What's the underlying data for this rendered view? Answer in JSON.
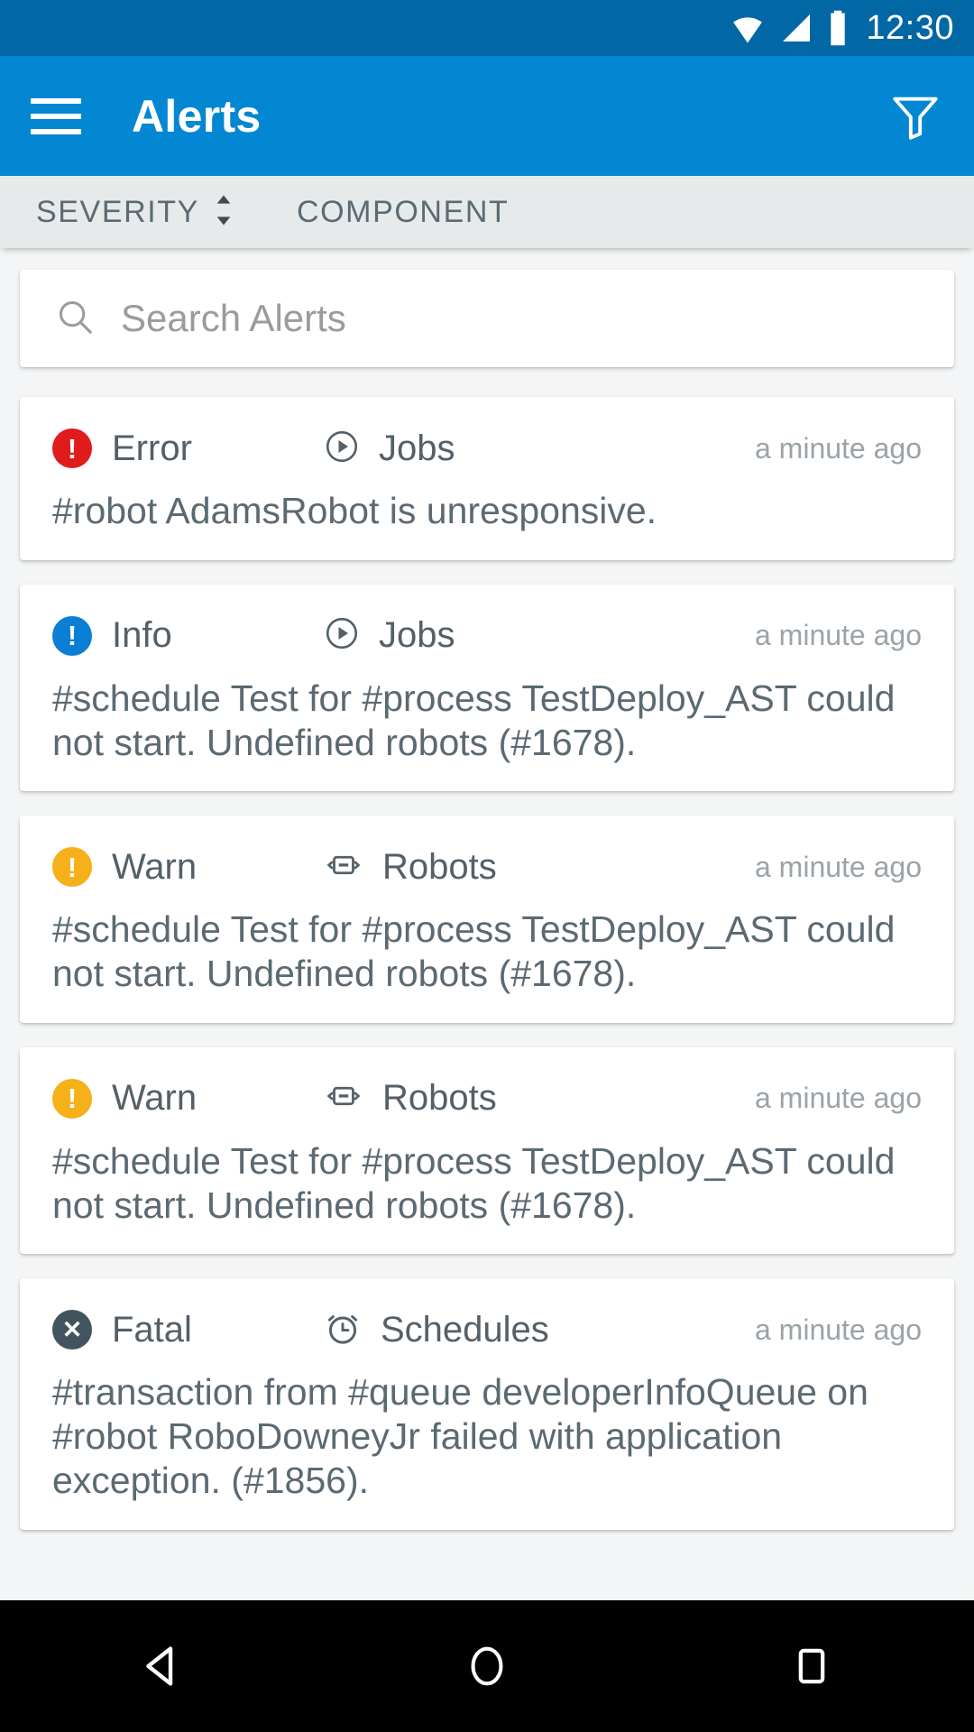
{
  "status_bar": {
    "time": "12:30",
    "icons": [
      "wifi-icon",
      "cellular-signal-icon",
      "battery-icon"
    ],
    "background_color": "#0267a5"
  },
  "app_bar": {
    "title": "Alerts",
    "menu_icon": "hamburger-menu-icon",
    "filter_icon": "filter-funnel-icon",
    "background_color": "#0487d2"
  },
  "sort_bar": {
    "items": [
      {
        "label": "SEVERITY",
        "icon": "sort-updown-icon",
        "active": true
      },
      {
        "label": "COMPONENT",
        "icon": "",
        "active": false
      }
    ]
  },
  "search": {
    "placeholder": "Search Alerts",
    "value": "",
    "icon": "search-icon"
  },
  "alerts": [
    {
      "severity": "Error",
      "severity_color": "#e01b1b",
      "severity_glyph": "!",
      "component": "Jobs",
      "component_icon": "play-circle-icon",
      "time": "a minute ago",
      "message": "#robot AdamsRobot is unresponsive."
    },
    {
      "severity": "Info",
      "severity_color": "#0b7fd4",
      "severity_glyph": "!",
      "component": "Jobs",
      "component_icon": "play-circle-icon",
      "time": "a minute ago",
      "message": "#schedule Test for #process TestDeploy_AST could not start. Undefined robots (#1678)."
    },
    {
      "severity": "Warn",
      "severity_color": "#f5b01a",
      "severity_glyph": "!",
      "component": "Robots",
      "component_icon": "robot-icon",
      "time": "a minute ago",
      "message": "#schedule Test for #process TestDeploy_AST could not start. Undefined robots (#1678)."
    },
    {
      "severity": "Warn",
      "severity_color": "#f5b01a",
      "severity_glyph": "!",
      "component": "Robots",
      "component_icon": "robot-icon",
      "time": "a minute ago",
      "message": "#schedule Test for #process TestDeploy_AST could not start. Undefined robots (#1678)."
    },
    {
      "severity": "Fatal",
      "severity_color": "#42555e",
      "severity_glyph": "✕",
      "component": "Schedules",
      "component_icon": "alarm-clock-icon",
      "time": "a minute ago",
      "message": "#transaction from #queue developerInfoQueue on #robot RoboDowneyJr failed with application exception. (#1856)."
    }
  ],
  "nav_bar": {
    "back_label": "back-button",
    "home_label": "home-button",
    "recents_label": "recents-button"
  }
}
